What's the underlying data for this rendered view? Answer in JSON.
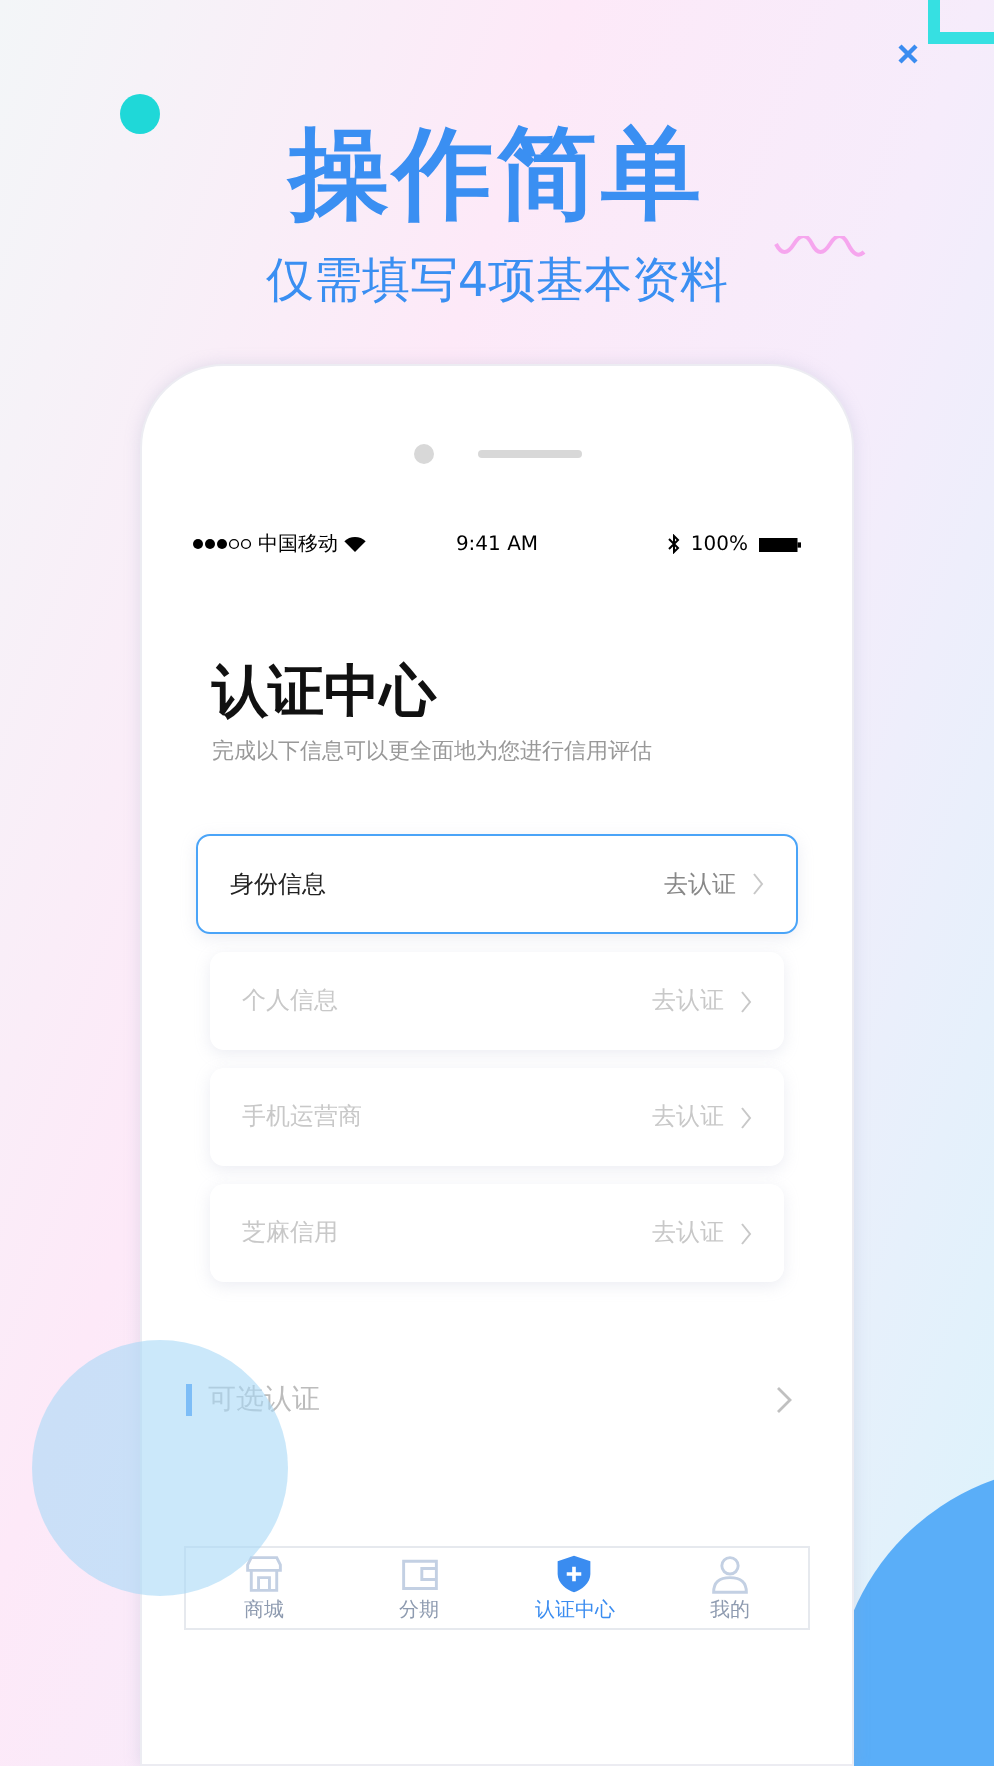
{
  "headline": "操作简单",
  "subheadline": "仅需填写4项基本资料",
  "status_bar": {
    "carrier": "中国移动",
    "time": "9:41 AM",
    "battery": "100%"
  },
  "page": {
    "title": "认证中心",
    "subtitle": "完成以下信息可以更全面地为您进行信用评估"
  },
  "items": [
    {
      "label": "身份信息",
      "action": "去认证",
      "selected": true
    },
    {
      "label": "个人信息",
      "action": "去认证",
      "selected": false
    },
    {
      "label": "手机运营商",
      "action": "去认证",
      "selected": false
    },
    {
      "label": "芝麻信用",
      "action": "去认证",
      "selected": false
    }
  ],
  "optional_section": {
    "label": "可选认证"
  },
  "tabs": [
    {
      "label": "商城",
      "kind": "store",
      "selected": false
    },
    {
      "label": "分期",
      "kind": "wallet",
      "selected": false
    },
    {
      "label": "认证中心",
      "kind": "shield",
      "selected": true
    },
    {
      "label": "我的",
      "kind": "person",
      "selected": false
    }
  ]
}
